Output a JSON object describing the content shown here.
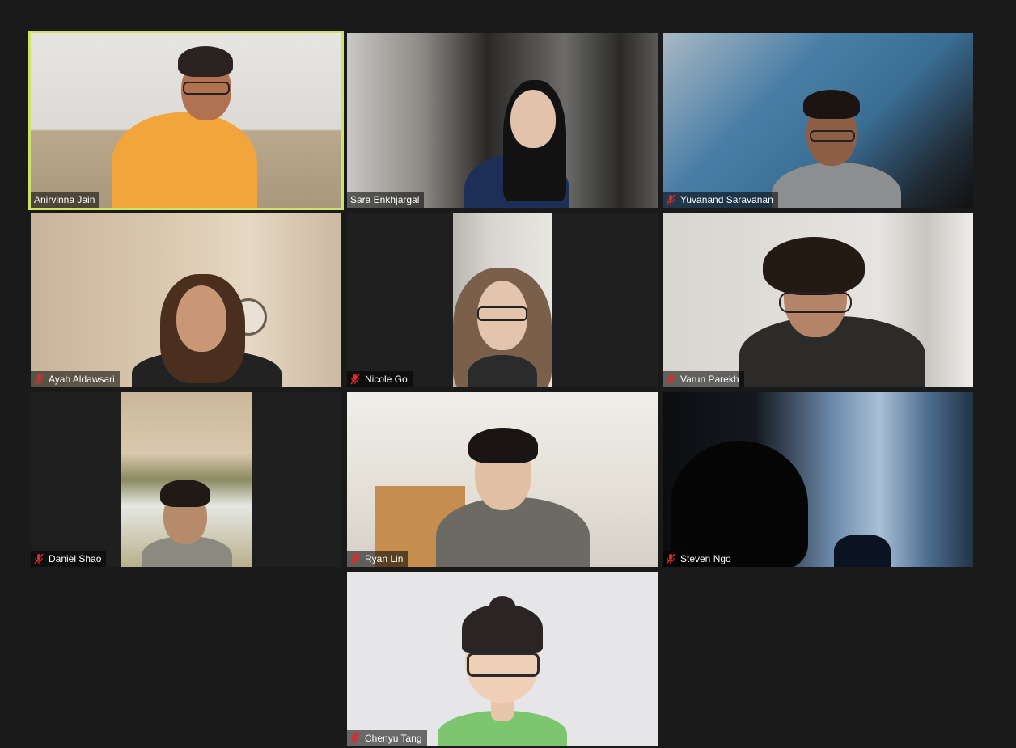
{
  "participants": [
    {
      "name": "Anirvinna Jain",
      "muted": false,
      "active_speaker": true
    },
    {
      "name": "Sara Enkhjargal",
      "muted": false,
      "active_speaker": false
    },
    {
      "name": "Yuvanand Saravanan",
      "muted": true,
      "active_speaker": false
    },
    {
      "name": "Ayah Aldawsari",
      "muted": true,
      "active_speaker": false
    },
    {
      "name": "Nicole Go",
      "muted": true,
      "active_speaker": false
    },
    {
      "name": "Varun Parekh",
      "muted": true,
      "active_speaker": false
    },
    {
      "name": "Daniel Shao",
      "muted": true,
      "active_speaker": false
    },
    {
      "name": "Ryan Lin",
      "muted": true,
      "active_speaker": false
    },
    {
      "name": "Steven Ngo",
      "muted": true,
      "active_speaker": false
    },
    {
      "name": "Chenyu Tang",
      "muted": true,
      "active_speaker": false
    }
  ],
  "colors": {
    "background": "#1a1a1a",
    "active_speaker_border": "#cfe36b",
    "muted_icon": "#e02828"
  },
  "icons": {
    "muted": "mic-muted-icon"
  }
}
